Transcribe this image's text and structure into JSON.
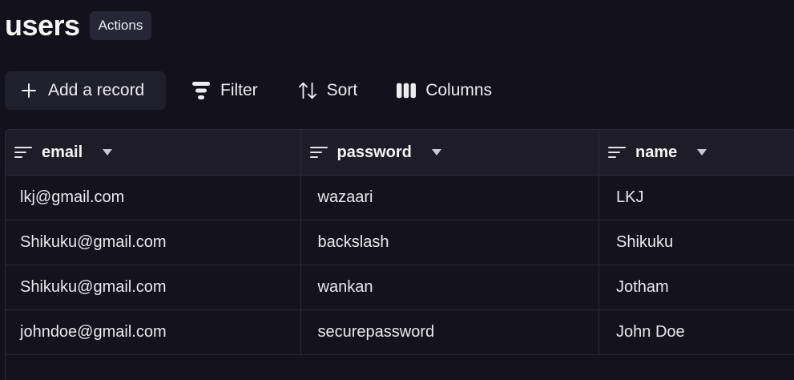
{
  "header": {
    "title": "users",
    "actions_label": "Actions"
  },
  "toolbar": {
    "add_label": "Add a record",
    "filter_label": "Filter",
    "sort_label": "Sort",
    "columns_label": "Columns",
    "icons": [
      "plus-icon",
      "filter-icon",
      "sort-icon",
      "columns-icon"
    ]
  },
  "table": {
    "columns": [
      {
        "label": "email",
        "icon": "text-column-icon"
      },
      {
        "label": "password",
        "icon": "text-column-icon"
      },
      {
        "label": "name",
        "icon": "text-column-icon"
      }
    ],
    "rows": [
      {
        "email": "lkj@gmail.com",
        "password": "wazaari",
        "name": "LKJ"
      },
      {
        "email": "Shikuku@gmail.com",
        "password": "backslash",
        "name": "Shikuku"
      },
      {
        "email": "Shikuku@gmail.com",
        "password": "wankan",
        "name": "Jotham"
      },
      {
        "email": "johndoe@gmail.com",
        "password": "securepassword",
        "name": "John Doe"
      }
    ]
  },
  "colors": {
    "background": "#13111c",
    "header_row": "#1e1c29",
    "button_bg": "#272635",
    "border": "#2c2a3a",
    "text": "#f4f4f5"
  }
}
